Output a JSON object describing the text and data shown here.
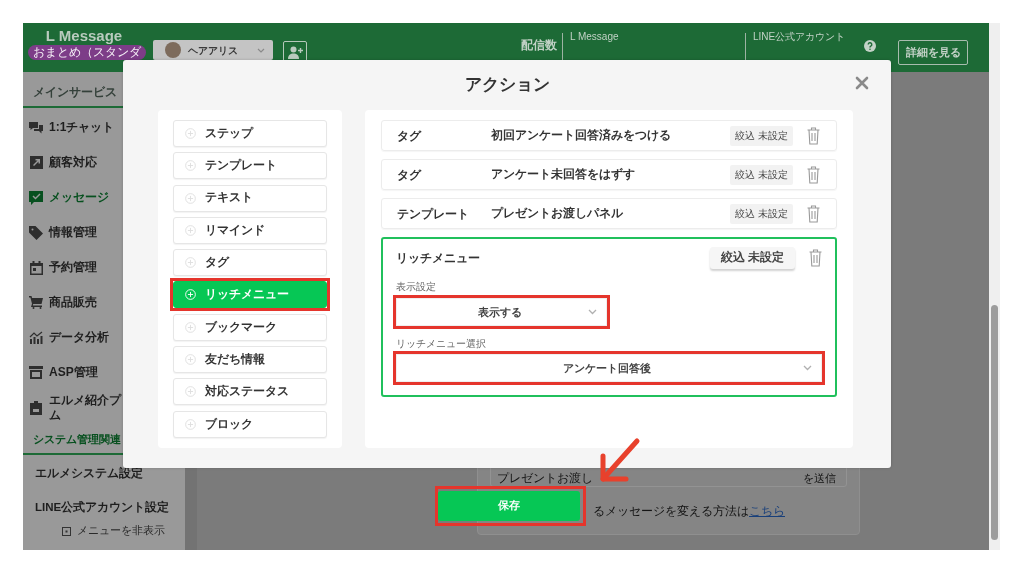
{
  "header": {
    "brand": "L Message",
    "plan_badge": "おまとめ（スタンダ",
    "account_selector": {
      "name": "ヘアアリス"
    },
    "delivery_count_label": "配信数",
    "delivery_columns": [
      "L Message",
      "LINE公式アカウント"
    ],
    "details_button": "詳細を見る"
  },
  "sidebar": {
    "main_section": {
      "title": "メインサービス",
      "items": [
        {
          "label": "1:1チャット",
          "selected": false
        },
        {
          "label": "顧客対応",
          "selected": false
        },
        {
          "label": "メッセージ",
          "selected": true
        },
        {
          "label": "情報管理",
          "selected": false
        },
        {
          "label": "予約管理",
          "selected": false
        },
        {
          "label": "商品販売",
          "selected": false
        },
        {
          "label": "データ分析",
          "selected": false
        },
        {
          "label": "ASP管理",
          "selected": false
        },
        {
          "label": "エルメ紹介プ",
          "label_line_2": "ム",
          "selected": false
        }
      ]
    },
    "system_section": {
      "title": "システム管理関連",
      "items": [
        {
          "label": "エルメシステム設定"
        },
        {
          "label": "LINE公式アカウント設定"
        }
      ]
    },
    "hide_menu": "メニューを非表示"
  },
  "main": {
    "card_row": {
      "text": "プレゼントお渡し",
      "action": "を送信"
    },
    "note": "るメッセージを変える方法は",
    "note_link": "こちら"
  },
  "action_modal": {
    "title": "アクション",
    "action_types": [
      {
        "label": "ステップ",
        "selected": false,
        "annotated": false
      },
      {
        "label": "テンプレート",
        "selected": false,
        "annotated": false
      },
      {
        "label": "テキスト",
        "selected": false,
        "annotated": false
      },
      {
        "label": "リマインド",
        "selected": false,
        "annotated": false
      },
      {
        "label": "タグ",
        "selected": false,
        "annotated": false
      },
      {
        "label": "リッチメニュー",
        "selected": true,
        "annotated": true
      },
      {
        "label": "ブックマーク",
        "selected": false,
        "annotated": false
      },
      {
        "label": "友だち情報",
        "selected": false,
        "annotated": false
      },
      {
        "label": "対応ステータス",
        "selected": false,
        "annotated": false
      },
      {
        "label": "ブロック",
        "selected": false,
        "annotated": false
      }
    ],
    "actions": [
      {
        "kind": "row",
        "type": "タグ",
        "value": "初回アンケート回答済みをつける",
        "filter": "絞込 未設定"
      },
      {
        "kind": "row",
        "type": "タグ",
        "value": "アンケート未回答をはずす",
        "filter": "絞込 未設定"
      },
      {
        "kind": "row",
        "type": "テンプレート",
        "value": "プレゼントお渡しパネル",
        "filter": "絞込 未設定"
      },
      {
        "kind": "expanded",
        "type": "リッチメニュー",
        "filter": "絞込 未設定",
        "fields": [
          {
            "label": "表示設定",
            "value": "表示する",
            "annotated": true
          },
          {
            "label": "リッチメニュー選択",
            "value": "アンケート回答後",
            "annotated": true
          }
        ]
      }
    ]
  },
  "save_button": {
    "label": "保存",
    "annotated": true
  }
}
